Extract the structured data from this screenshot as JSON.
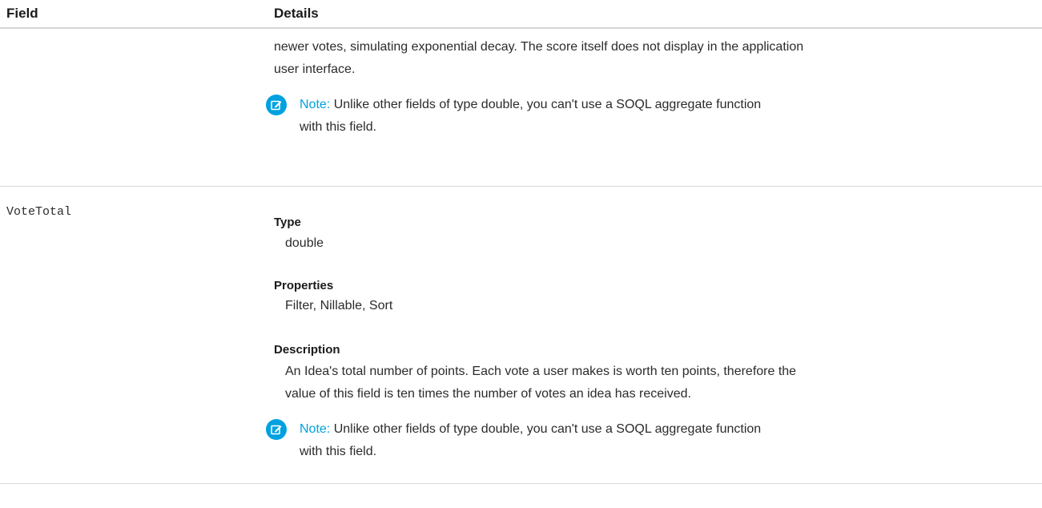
{
  "table": {
    "header": {
      "field": "Field",
      "details": "Details"
    }
  },
  "continued_row": {
    "description_line1": "newer votes, simulating exponential decay. The score itself does not display in the application",
    "description_line2": "user interface.",
    "note": {
      "label": "Note:",
      "line1": "Unlike other fields of type double, you can't use a SOQL aggregate function",
      "line2": "with this field."
    }
  },
  "vote_total_row": {
    "field_name": "VoteTotal",
    "type_label": "Type",
    "type_value": "double",
    "properties_label": "Properties",
    "properties_value": "Filter, Nillable, Sort",
    "description_label": "Description",
    "description_line1": "An Idea's total number of points. Each vote a user makes is worth ten points, therefore the",
    "description_line2": "value of this field is ten times the number of votes an idea has received.",
    "note": {
      "label": "Note:",
      "line1": "Unlike other fields of type double, you can't use a SOQL aggregate function",
      "line2": "with this field."
    }
  },
  "icons": {
    "note": "edit-note-icon"
  },
  "colors": {
    "accent": "#00a1e0",
    "divider": "#d8d8d8",
    "text": "#2b2b2b"
  }
}
